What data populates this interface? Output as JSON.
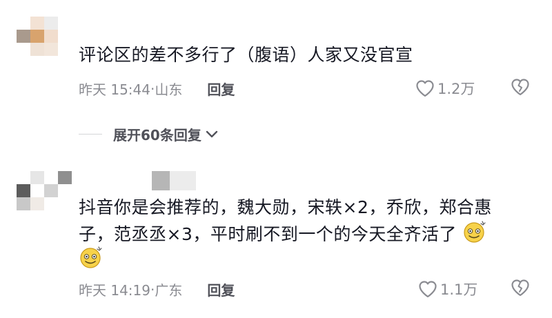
{
  "comments": [
    {
      "text": "评论区的差不多行了（腹语）人家又没官宣",
      "time": "昨天 15:44",
      "location": "山东",
      "reply_label": "回复",
      "likes": "1.2万"
    },
    {
      "line1": "抖音你是会推荐的，魏大勋，宋轶×2，乔欣，郑合惠",
      "line2": "子，范丞丞×3，平时刷不到一个的今天全齐活了",
      "time": "昨天 14:19",
      "location": "广东",
      "reply_label": "回复",
      "likes": "1.1万"
    }
  ],
  "expand_replies": "展开60条回复",
  "icons": {
    "like": "heart-outline-icon",
    "dislike": "broken-heart-icon",
    "expand": "chevron-down-icon",
    "emoji": "dizzy-smile-emoji-icon"
  },
  "colors": {
    "text": "#161823",
    "meta": "#8a8b91",
    "reply": "#505159"
  }
}
